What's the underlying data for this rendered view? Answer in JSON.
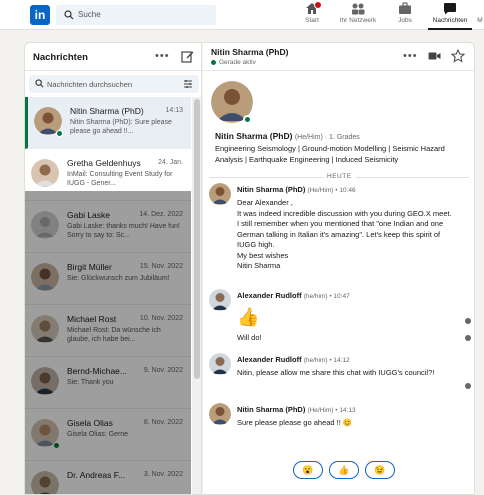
{
  "nav": {
    "logo_text": "in",
    "search_placeholder": "Suche",
    "items": [
      {
        "label": "Start",
        "icon": "home-icon"
      },
      {
        "label": "Ihr Netzwerk",
        "icon": "network-icon"
      },
      {
        "label": "Jobs",
        "icon": "briefcase-icon"
      },
      {
        "label": "Nachrichten",
        "icon": "messaging-icon"
      },
      {
        "label": "M",
        "icon": ""
      }
    ]
  },
  "sidebar": {
    "title": "Nachrichten",
    "search_placeholder": "Nachrichten durchsuchen",
    "conversations": [
      {
        "name": "Nitin Sharma (PhD)",
        "date": "14:13",
        "snippet": "Nitin Sharma (PhD): Sure please please go ahead !!..."
      },
      {
        "name": "Gretha Geldenhuys",
        "date": "24. Jan.",
        "snippet": "InMail: Consulting Event Study for IUGG - Gener..."
      },
      {
        "name": "Gabi Laske",
        "date": "14. Dez. 2022",
        "snippet": "Gabi Laske: thanks much! Have fun! Sorry to say to: Sc..."
      },
      {
        "name": "Birgit Müller",
        "date": "15. Nov. 2022",
        "snippet": "Sie: Glückwunsch zum Jubiläum!"
      },
      {
        "name": "Michael Rost",
        "date": "10. Nov. 2022",
        "snippet": "Michael Rost: Da wünsche ich glaube, ich habe bei..."
      },
      {
        "name": "Bernd-Michae...",
        "date": "9. Nov. 2022",
        "snippet": "Sie: Thank you"
      },
      {
        "name": "Gisela Olias",
        "date": "8. Nov. 2022",
        "snippet": "Gisela Olias: Gerne"
      },
      {
        "name": "Dr. Andreas F...",
        "date": "3. Nov. 2022",
        "snippet": ""
      }
    ]
  },
  "chat": {
    "name": "Nitin Sharma (PhD)",
    "status": "Gerade aktiv",
    "profile": {
      "name": "Nitin Sharma (PhD)",
      "pronouns_degree": "(He/Him) · 1. Grades",
      "headline": "Engineering Seismology | Ground-motion Modelling | Seismic Hazard Analysis | Earthquake Engineering | Induced Seismicity"
    },
    "day_label": "HEUTE",
    "messages": [
      {
        "sender": "Nitin Sharma (PhD)",
        "meta": "(He/Him) • 10:46",
        "lines": [
          "Dear Alexander ,",
          "It was indeed incredible discussion with you during GEO.X meet. I still remember when you mentioned that \"one Indian and one German talking in Italian it's amazing\". Let's keep this spirit of IUGG high.",
          "My best wishes",
          "Nitin Sharma"
        ]
      },
      {
        "sender": "Alexander Rudloff",
        "meta": "(he/him) • 10:47",
        "lines": [
          "👍",
          "Will do!"
        ]
      },
      {
        "sender": "Alexander Rudloff",
        "meta": "(he/him) • 14:12",
        "lines": [
          "Nitin, please allow me share this chat with IUGG's council?!"
        ]
      },
      {
        "sender": "Nitin Sharma (PhD)",
        "meta": "(He/Him) • 14:13",
        "lines": [
          "Sure please please go ahead !! 😊"
        ]
      }
    ],
    "reactions": [
      "😮",
      "👍",
      "😉"
    ]
  },
  "colors": {
    "brand": "#0a66c2",
    "online": "#057642",
    "overlay": "rgba(0,0,0,0.38)"
  }
}
